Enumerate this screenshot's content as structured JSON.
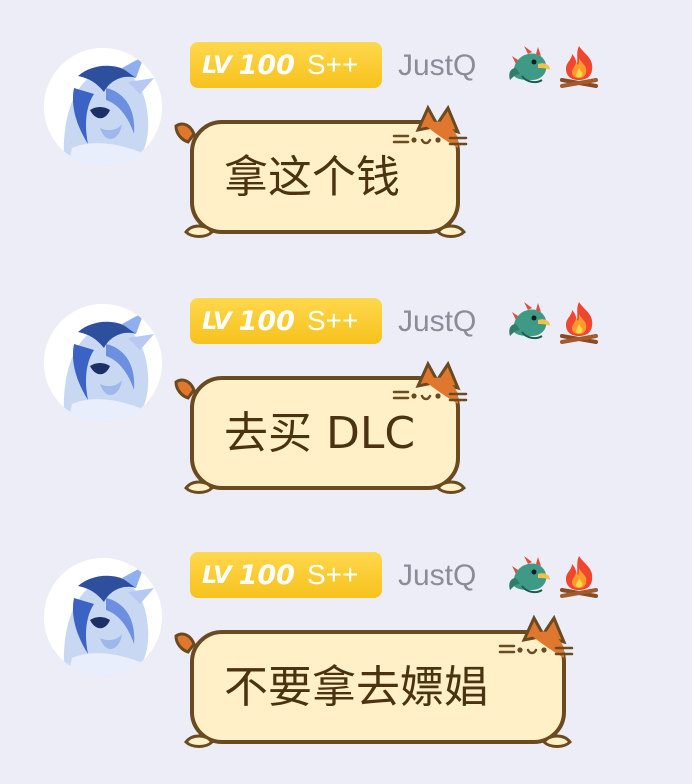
{
  "messages": [
    {
      "level_prefix": "LV",
      "level_number": "100",
      "rank": "S++",
      "username": "JustQ",
      "text": "拿这个钱",
      "badges": [
        "dragon-icon",
        "fire-icon"
      ]
    },
    {
      "level_prefix": "LV",
      "level_number": "100",
      "rank": "S++",
      "username": "JustQ",
      "text": "去买 DLC",
      "badges": [
        "dragon-icon",
        "fire-icon"
      ]
    },
    {
      "level_prefix": "LV",
      "level_number": "100",
      "rank": "S++",
      "username": "JustQ",
      "text": "不要拿去嫖娼",
      "badges": [
        "dragon-icon",
        "fire-icon"
      ]
    }
  ],
  "colors": {
    "background": "#ecedf7",
    "badge_gold": "#f6c21d",
    "bubble_fill": "#fff0c8",
    "bubble_border": "#6b4a1f",
    "cat_orange": "#e0772f",
    "text_brown": "#4b3312",
    "username_gray": "#8a8c99"
  }
}
